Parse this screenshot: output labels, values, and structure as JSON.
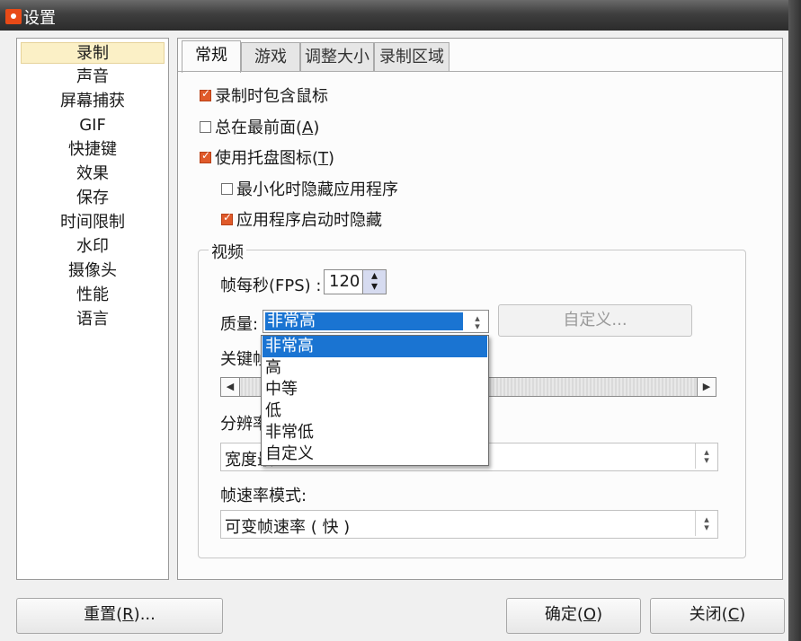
{
  "window": {
    "title": "设置"
  },
  "sidebar": {
    "items": [
      {
        "label": "录制"
      },
      {
        "label": "声音"
      },
      {
        "label": "屏幕捕获"
      },
      {
        "label": "GIF"
      },
      {
        "label": "快捷键"
      },
      {
        "label": "效果"
      },
      {
        "label": "保存"
      },
      {
        "label": "时间限制"
      },
      {
        "label": "水印"
      },
      {
        "label": "摄像头"
      },
      {
        "label": "性能"
      },
      {
        "label": "语言"
      }
    ],
    "selected": "录制"
  },
  "tabs": [
    {
      "label": "常规"
    },
    {
      "label": "游戏"
    },
    {
      "label": "调整大小"
    },
    {
      "label": "录制区域"
    }
  ],
  "general": {
    "include_cursor": {
      "label": "录制时包含鼠标",
      "checked": true
    },
    "always_on_top": {
      "label_pre": "总在最前面(",
      "key": "A",
      "label_post": ")",
      "checked": false
    },
    "tray_icon": {
      "label_pre": "使用托盘图标(",
      "key": "T",
      "label_post": ")",
      "checked": true
    },
    "hide_on_minimize": {
      "label": "最小化时隐藏应用程序",
      "checked": false
    },
    "hide_on_start": {
      "label": "应用程序启动时隐藏",
      "checked": true
    }
  },
  "video": {
    "group_title": "视频",
    "fps_label": "帧每秒(FPS) :",
    "fps_value": "120",
    "quality_label": "质量:",
    "quality_value": "非常高",
    "custom_button": "自定义...",
    "keyframe_label": "关键帧",
    "resolution_label": "分辨率",
    "resolution_value": "宽度最",
    "frame_rate_mode_label": "帧速率模式:",
    "frame_rate_mode_value": "可变帧速率 ( 快 )"
  },
  "quality_dropdown": {
    "options": [
      "非常高",
      "高",
      "中等",
      "低",
      "非常低",
      "自定义"
    ],
    "selected": "非常高"
  },
  "buttons": {
    "reset": {
      "pre": "重置(",
      "key": "R",
      "post": ")..."
    },
    "ok": {
      "pre": "确定(",
      "key": "O",
      "post": ")"
    },
    "close": {
      "pre": "关闭(",
      "key": "C",
      "post": ")"
    }
  },
  "colors": {
    "accent": "#e05a2a",
    "selection": "#1a74d2",
    "sidebar_selected": "#fbf0c6"
  }
}
